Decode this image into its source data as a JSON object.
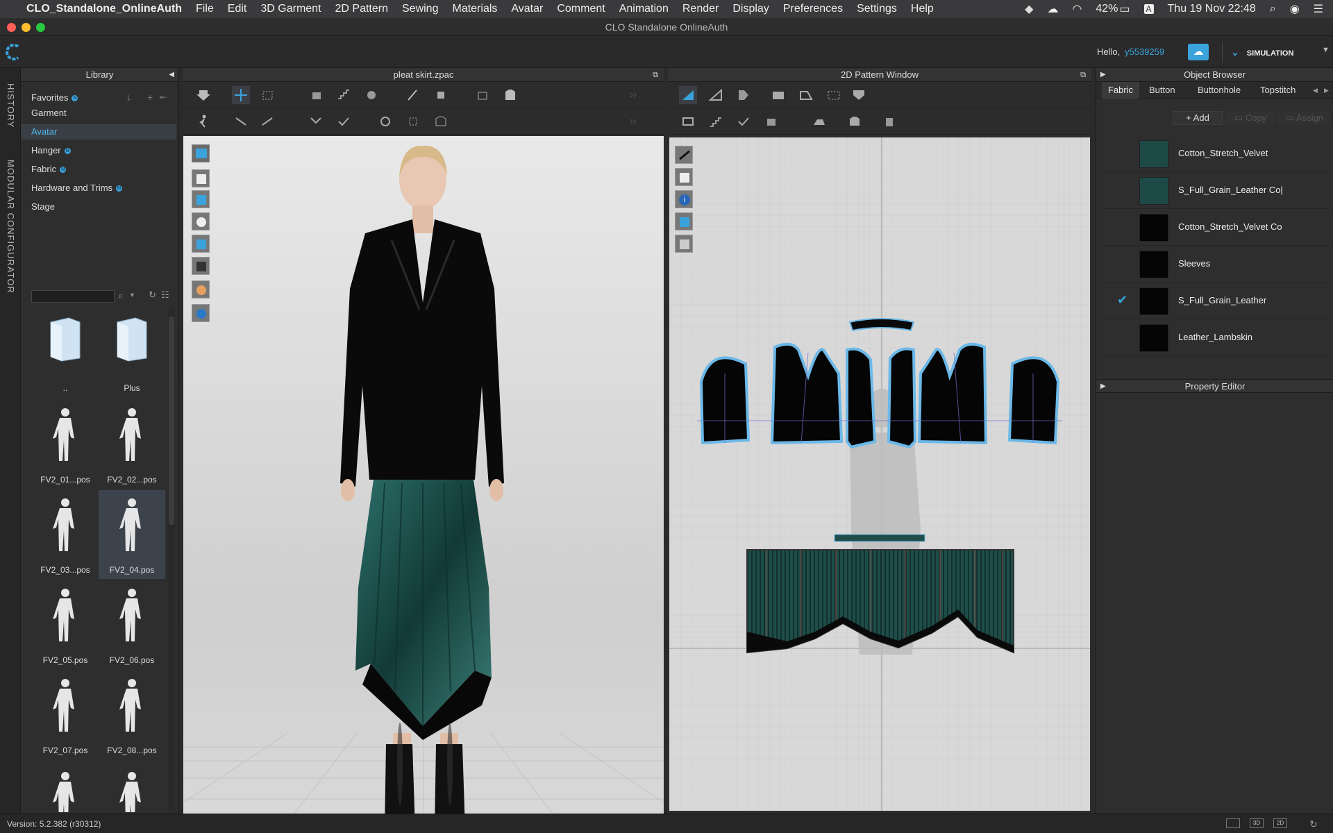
{
  "menubar": {
    "app_name": "CLO_Standalone_OnlineAuth",
    "items": [
      "File",
      "Edit",
      "3D Garment",
      "2D Pattern",
      "Sewing",
      "Materials",
      "Avatar",
      "Comment",
      "Animation",
      "Render",
      "Display",
      "Preferences",
      "Settings",
      "Help"
    ],
    "battery": "42%",
    "datetime": "Thu 19 Nov  22:48",
    "input_source": "A"
  },
  "window": {
    "title": "CLO Standalone OnlineAuth"
  },
  "topbar": {
    "greeting": "Hello,",
    "username": "y5539259",
    "mode": "SIMULATION"
  },
  "vertical_tabs": [
    "HISTORY",
    "MODULAR CONFIGURATOR"
  ],
  "library": {
    "title": "Library",
    "items": [
      {
        "label": "Favorites",
        "badge": "N"
      },
      {
        "label": "Garment",
        "badge": ""
      },
      {
        "label": "Avatar",
        "badge": ""
      },
      {
        "label": "Hanger",
        "badge": "N"
      },
      {
        "label": "Fabric",
        "badge": "N"
      },
      {
        "label": "Hardware and Trims",
        "badge": "N"
      },
      {
        "label": "Stage",
        "badge": ""
      }
    ],
    "search_placeholder": "",
    "thumbs": [
      {
        "label": "..",
        "kind": "folder"
      },
      {
        "label": "Plus",
        "kind": "folder"
      },
      {
        "label": "FV2_01...pos",
        "kind": "pose"
      },
      {
        "label": "FV2_02...pos",
        "kind": "pose"
      },
      {
        "label": "FV2_03...pos",
        "kind": "pose"
      },
      {
        "label": "FV2_04.pos",
        "kind": "pose"
      },
      {
        "label": "FV2_05.pos",
        "kind": "pose"
      },
      {
        "label": "FV2_06.pos",
        "kind": "pose"
      },
      {
        "label": "FV2_07.pos",
        "kind": "pose"
      },
      {
        "label": "FV2_08...pos",
        "kind": "pose"
      }
    ]
  },
  "viewport3d": {
    "title": "pleat skirt.zpac"
  },
  "pattern2d": {
    "title": "2D Pattern Window"
  },
  "object_browser": {
    "title": "Object Browser",
    "tabs": [
      "Fabric",
      "Button",
      "Buttonhole",
      "Topstitch"
    ],
    "actions": {
      "add": "Add",
      "copy": "Copy",
      "assign": "Assign"
    },
    "fabrics": [
      {
        "name": "Cotton_Stretch_Velvet",
        "color": "#1d4a47",
        "checked": false
      },
      {
        "name": "S_Full_Grain_Leather Co|",
        "color": "#1d4a47",
        "checked": false
      },
      {
        "name": "Cotton_Stretch_Velvet Co",
        "color": "#050505",
        "checked": false
      },
      {
        "name": "Sleeves",
        "color": "#050505",
        "checked": false
      },
      {
        "name": "S_Full_Grain_Leather",
        "color": "#050505",
        "checked": true
      },
      {
        "name": "Leather_Lambskin",
        "color": "#050505",
        "checked": false
      }
    ]
  },
  "property_editor": {
    "title": "Property Editor"
  },
  "status": {
    "version": "Version: 5.2.382 (r30312)"
  },
  "colors": {
    "accent": "#3aa3dc",
    "velvet": "#1d4a47",
    "pattern_outline": "#6bb8e8"
  }
}
